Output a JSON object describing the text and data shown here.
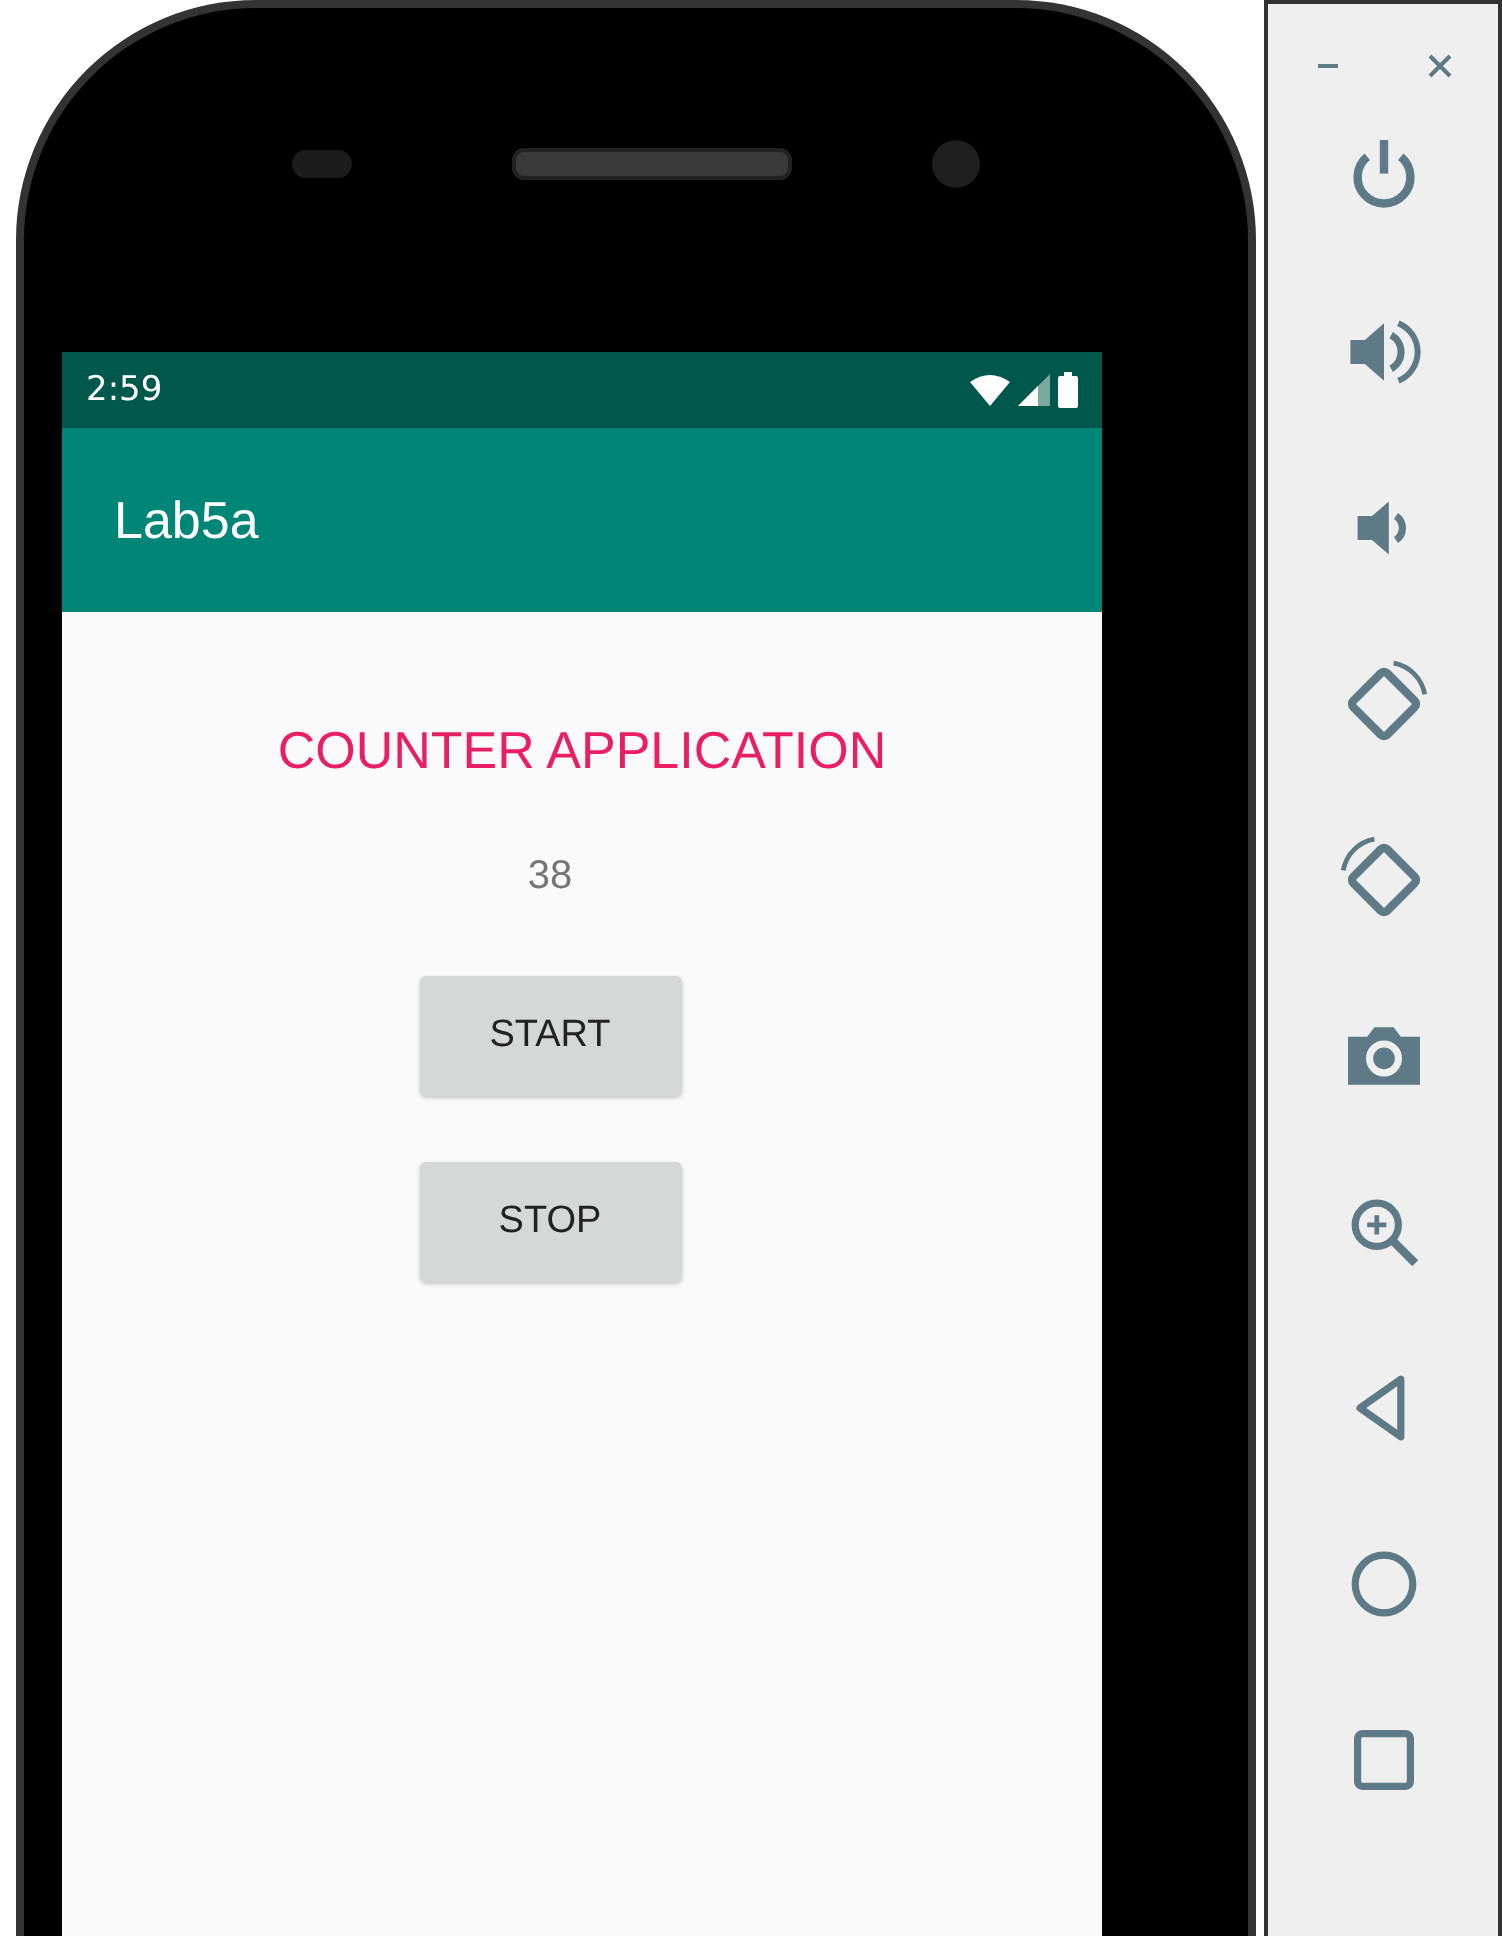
{
  "status_bar": {
    "time": "2:59"
  },
  "app_bar": {
    "title": "Lab5a"
  },
  "content": {
    "heading": "COUNTER APPLICATION",
    "counter": "38"
  },
  "buttons": [
    {
      "label": "START"
    },
    {
      "label": "STOP"
    }
  ]
}
